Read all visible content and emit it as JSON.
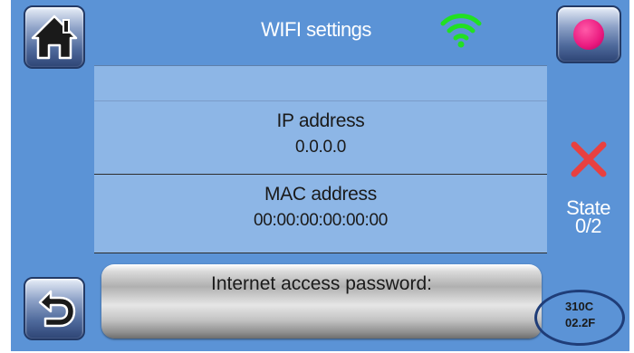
{
  "header": {
    "title": "WIFI settings",
    "wifi_icon": "wifi-icon",
    "wifi_color": "#22e022"
  },
  "info": {
    "ip_label": "IP address",
    "ip_value": "0.0.0.0",
    "mac_label": "MAC address",
    "mac_value": "00:00:00:00:00:00"
  },
  "password_button": {
    "label": "Internet access password:"
  },
  "left_nav": {
    "home_icon": "home-icon",
    "back_icon": "back-arrow-icon"
  },
  "right_panel": {
    "record_icon": "record-icon",
    "record_color": "#ea1a7f",
    "status_icon": "close-icon",
    "status_color": "#e84040",
    "state_label": "State",
    "state_value": "0/2",
    "version_line1": "310C",
    "version_line2": "02.2F"
  },
  "colors": {
    "panel_blue": "#5b93d6",
    "row_blue": "#8db6e6"
  }
}
